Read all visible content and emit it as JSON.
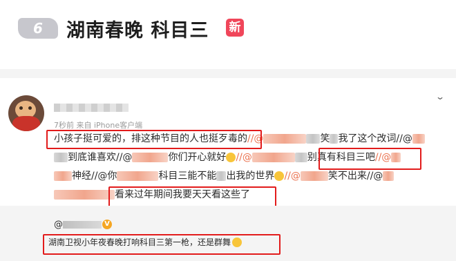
{
  "trend": {
    "rank": "6",
    "title": "湖南春晚 科目三",
    "badge": "新"
  },
  "post": {
    "meta": "7秒前 来自 iPhone客户端",
    "line1": {
      "text": "小孩子挺可爱的，排这种节目的人也挺歹毒的",
      "sep": "//@",
      "mid": "笑",
      "tail": "我了这个改词//@"
    },
    "line2": {
      "a": "到底谁喜欢//@",
      "b": "你们开心就好",
      "c": "//@",
      "d": "别真有科目三吧",
      "e": "//@"
    },
    "line3": {
      "a": "神经//@你",
      "b": "科目三能不能",
      "c": "出我的世界",
      "d": "//@",
      "e": "笑不出来//@"
    },
    "line4": {
      "a": "看来过年期间我要天天看这些了"
    }
  },
  "repost": {
    "at": "@",
    "vip": "V",
    "text": "湖南卫视小年夜春晚打响科目三第一枪，还是群舞"
  },
  "icons": {
    "expand": "chevron-down-icon",
    "verified": "vip-badge-icon",
    "emoji": "grin-emoji-icon"
  },
  "colors": {
    "badge": "#f0465a",
    "highlight_box": "#e21b1b",
    "link": "#eb7350"
  }
}
